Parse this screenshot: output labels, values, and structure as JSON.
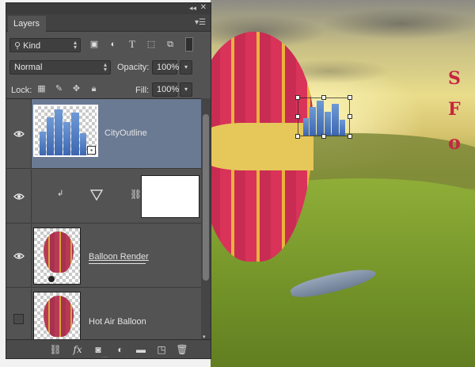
{
  "panel": {
    "tab_label": "Layers",
    "filter": {
      "kind_label": "Kind"
    },
    "blend": {
      "mode": "Normal",
      "opacity_label": "Opacity:",
      "opacity_value": "100%"
    },
    "lock": {
      "label": "Lock:",
      "fill_label": "Fill:",
      "fill_value": "100%"
    },
    "layers": [
      {
        "name": "CityOutline",
        "visible": true,
        "selected": true
      },
      {
        "name": "",
        "visible": true,
        "selected": false,
        "type": "adjustment"
      },
      {
        "name": "Balloon Render",
        "visible": true,
        "selected": false
      },
      {
        "name": "Hot Air Balloon",
        "visible": false,
        "selected": false
      }
    ]
  },
  "canvas": {
    "balloon_letters": [
      "S",
      "F",
      "o"
    ]
  },
  "colors": {
    "panel_bg": "#535353",
    "selected_row": "#6b7a93",
    "accent_city": "#3c66b0"
  }
}
